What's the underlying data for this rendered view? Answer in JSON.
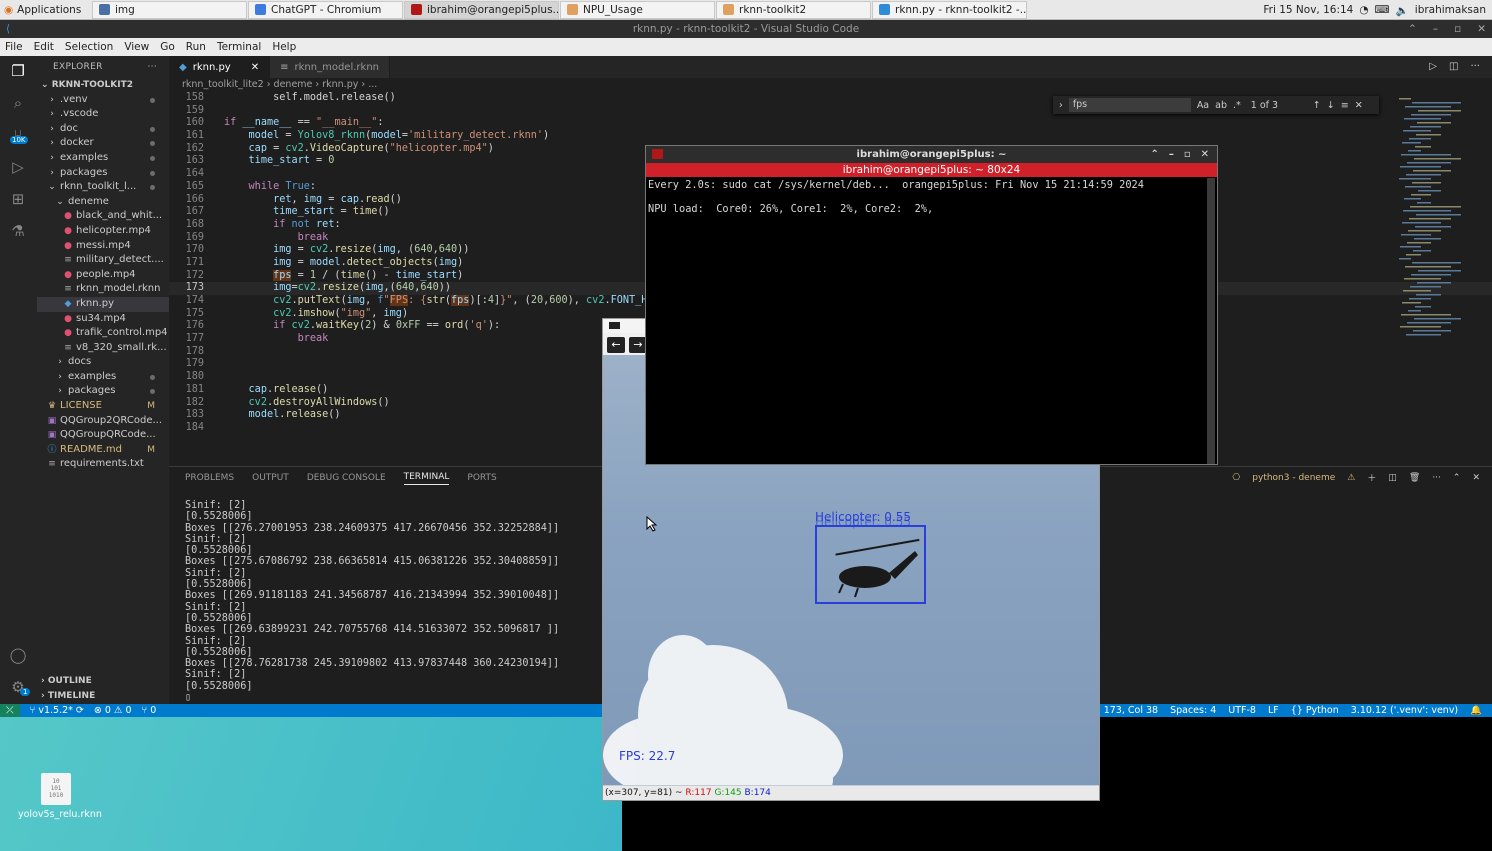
{
  "taskbar": {
    "apps_label": "Applications",
    "tabs": [
      {
        "label": "img",
        "icon": "window-icon",
        "active": false
      },
      {
        "label": "ChatGPT - Chromium",
        "icon": "chromium-icon",
        "active": false
      },
      {
        "label": "ibrahim@orangepi5plus...",
        "icon": "terminal-icon",
        "active": true
      },
      {
        "label": "NPU_Usage",
        "icon": "folder-icon",
        "active": false
      },
      {
        "label": "rknn-toolkit2",
        "icon": "folder-icon",
        "active": false
      },
      {
        "label": "rknn.py - rknn-toolkit2 -...",
        "icon": "vscode-icon",
        "active": false
      }
    ],
    "clock": "Fri 15 Nov, 16:14",
    "user": "ibrahimaksan"
  },
  "window_title": "rknn.py - rknn-toolkit2 - Visual Studio Code",
  "menu": [
    "File",
    "Edit",
    "Selection",
    "View",
    "Go",
    "Run",
    "Terminal",
    "Help"
  ],
  "explorer": {
    "header": "EXPLORER",
    "project": "RKNN-TOOLKIT2",
    "source_control_badge": "10K",
    "settings_badge": "1",
    "items": [
      {
        "label": ".venv",
        "indent": 1,
        "type": "folder",
        "mark": "dot"
      },
      {
        "label": ".vscode",
        "indent": 1,
        "type": "folder",
        "mark": ""
      },
      {
        "label": "doc",
        "indent": 1,
        "type": "folder",
        "mark": "dot"
      },
      {
        "label": "docker",
        "indent": 1,
        "type": "folder",
        "mark": "dot"
      },
      {
        "label": "examples",
        "indent": 1,
        "type": "folder",
        "mark": "dot"
      },
      {
        "label": "packages",
        "indent": 1,
        "type": "folder",
        "mark": "dot"
      },
      {
        "label": "rknn_toolkit_l...",
        "indent": 1,
        "type": "folder-open",
        "mark": "dot"
      },
      {
        "label": "deneme",
        "indent": 2,
        "type": "folder-open",
        "mark": ""
      },
      {
        "label": "black_and_whit...",
        "indent": 3,
        "type": "media",
        "mark": ""
      },
      {
        "label": "helicopter.mp4",
        "indent": 3,
        "type": "media",
        "mark": ""
      },
      {
        "label": "messi.mp4",
        "indent": 3,
        "type": "media",
        "mark": ""
      },
      {
        "label": "military_detect....",
        "indent": 3,
        "type": "file",
        "mark": ""
      },
      {
        "label": "people.mp4",
        "indent": 3,
        "type": "media",
        "mark": ""
      },
      {
        "label": "rknn_model.rknn",
        "indent": 3,
        "type": "file",
        "mark": ""
      },
      {
        "label": "rknn.py",
        "indent": 3,
        "type": "python",
        "mark": "",
        "selected": true
      },
      {
        "label": "su34.mp4",
        "indent": 3,
        "type": "media",
        "mark": ""
      },
      {
        "label": "trafik_control.mp4",
        "indent": 3,
        "type": "media",
        "mark": ""
      },
      {
        "label": "v8_320_small.rk...",
        "indent": 3,
        "type": "file",
        "mark": ""
      },
      {
        "label": "docs",
        "indent": 2,
        "type": "folder",
        "mark": ""
      },
      {
        "label": "examples",
        "indent": 2,
        "type": "folder",
        "mark": "dot"
      },
      {
        "label": "packages",
        "indent": 2,
        "type": "folder",
        "mark": "dot"
      },
      {
        "label": "LICENSE",
        "indent": 1,
        "type": "license",
        "mark": "M"
      },
      {
        "label": "QQGroup2QRCode...",
        "indent": 1,
        "type": "image",
        "mark": ""
      },
      {
        "label": "QQGroupQRCode...",
        "indent": 1,
        "type": "image",
        "mark": ""
      },
      {
        "label": "README.md",
        "indent": 1,
        "type": "info",
        "mark": "M"
      },
      {
        "label": "requirements.txt",
        "indent": 1,
        "type": "file",
        "mark": ""
      }
    ],
    "outline": "OUTLINE",
    "timeline": "TIMELINE"
  },
  "editor": {
    "tabs": [
      {
        "label": "rknn.py",
        "active": true
      },
      {
        "label": "rknn_model.rknn",
        "active": false
      }
    ],
    "breadcrumb": [
      "rknn_toolkit_lite2",
      "deneme",
      "rknn.py",
      "..."
    ],
    "find": {
      "query": "fps",
      "count": "1 of 3"
    },
    "lines": [
      {
        "n": "158",
        "html": "        self.model.release()"
      },
      {
        "n": "159",
        "html": ""
      },
      {
        "n": "160",
        "html": "<span class='kw'>if</span> <span class='var'>__name__</span> == <span class='str'>\"__main__\"</span>:"
      },
      {
        "n": "161",
        "html": "    <span class='var'>model</span> = <span class='cls'>Yolov8_rknn</span>(<span class='var'>model</span>=<span class='str'>'military_detect.rknn'</span>)"
      },
      {
        "n": "162",
        "html": "    <span class='var'>cap</span> = <span class='cls'>cv2</span>.<span class='fn'>VideoCapture</span>(<span class='str'>\"helicopter.mp4\"</span>)"
      },
      {
        "n": "163",
        "html": "    <span class='var'>time_start</span> = <span class='num'>0</span>"
      },
      {
        "n": "164",
        "html": ""
      },
      {
        "n": "165",
        "html": "    <span class='kw'>while</span> <span class='kw2'>True</span>:"
      },
      {
        "n": "166",
        "html": "        <span class='var'>ret</span>, <span class='var'>img</span> = <span class='var'>cap</span>.<span class='fn'>read</span>()"
      },
      {
        "n": "167",
        "html": "        <span class='var'>time_start</span> = <span class='fn'>time</span>()"
      },
      {
        "n": "168",
        "html": "        <span class='kw'>if</span> <span class='kw2'>not</span> <span class='var'>ret</span>:"
      },
      {
        "n": "169",
        "html": "            <span class='kw'>break</span>"
      },
      {
        "n": "170",
        "html": "        <span class='var'>img</span> = <span class='cls'>cv2</span>.<span class='fn'>resize</span>(<span class='var'>img</span>, (<span class='num'>640</span>,<span class='num'>640</span>))"
      },
      {
        "n": "171",
        "html": "        <span class='var'>img</span> = <span class='var'>model</span>.<span class='fn'>detect_objects</span>(<span class='var'>img</span>)"
      },
      {
        "n": "172",
        "html": "        <span class='var hl'>fps</span> = <span class='num'>1</span> / (<span class='fn'>time</span>() - <span class='var'>time_start</span>)"
      },
      {
        "n": "173",
        "html": "        <span class='var'>img</span>=<span class='cls'>cv2</span>.<span class='fn'>resize</span>(<span class='var'>img</span>,(<span class='num'>640</span>,<span class='num'>640</span>))",
        "cur": true
      },
      {
        "n": "174",
        "html": "        <span class='cls'>cv2</span>.<span class='fn'>putText</span>(<span class='var'>img</span>, <span class='kw2'>f</span><span class='str'>\"<span class='hl'>FPS</span>: {</span><span class='fn'>str</span>(<span class='var hl'>fps</span>)[:<span class='num'>4</span>]<span class='str'>}\"</span>, (<span class='num'>20</span>,<span class='num'>600</span>), <span class='cls'>cv2</span>.<span class='var'>FONT_HERSHEY_SIMPLEX</span>"
      },
      {
        "n": "175",
        "html": "        <span class='cls'>cv2</span>.<span class='fn'>imshow</span>(<span class='str'>\"img\"</span>, <span class='var'>img</span>)"
      },
      {
        "n": "176",
        "html": "        <span class='kw'>if</span> <span class='cls'>cv2</span>.<span class='fn'>waitKey</span>(<span class='num'>2</span>) &amp; <span class='num'>0xFF</span> == <span class='fn'>ord</span>(<span class='str'>'q'</span>):"
      },
      {
        "n": "177",
        "html": "            <span class='kw'>break</span>"
      },
      {
        "n": "178",
        "html": ""
      },
      {
        "n": "179",
        "html": ""
      },
      {
        "n": "180",
        "html": ""
      },
      {
        "n": "181",
        "html": "    <span class='var'>cap</span>.<span class='fn'>release</span>()"
      },
      {
        "n": "182",
        "html": "    <span class='cls'>cv2</span>.<span class='fn'>destroyAllWindows</span>()"
      },
      {
        "n": "183",
        "html": "    <span class='var'>model</span>.<span class='fn'>release</span>()"
      },
      {
        "n": "184",
        "html": ""
      }
    ]
  },
  "panel": {
    "tabs": [
      "PROBLEMS",
      "OUTPUT",
      "DEBUG CONSOLE",
      "TERMINAL",
      "PORTS"
    ],
    "active_tab": "TERMINAL",
    "terminal_name": "python3 - deneme",
    "lines": [
      "Sinif: [2]",
      "[0.5528006]",
      "Boxes [[276.27001953 238.24609375 417.26670456 352.32252884]]",
      "Sinif: [2]",
      "[0.5528006]",
      "Boxes [[275.67086792 238.66365814 415.06381226 352.30408859]]",
      "Sinif: [2]",
      "[0.5528006]",
      "Boxes [[269.91181183 241.34568787 416.21343994 352.39010048]]",
      "Sinif: [2]",
      "[0.5528006]",
      "Boxes [[269.63899231 242.70755768 414.51633072 352.5096817 ]]",
      "Sinif: [2]",
      "[0.5528006]",
      "Boxes [[278.76281738 245.39109802 413.97837448 360.24230194]]",
      "Sinif: [2]",
      "[0.5528006]",
      "▯"
    ]
  },
  "status": {
    "branch": "v1.5.2*",
    "errors": "0",
    "warnings": "0",
    "ports": "0",
    "position": "n 173, Col 38",
    "spaces": "Spaces: 4",
    "encoding": "UTF-8",
    "eol": "LF",
    "language": "Python",
    "interpreter": "3.10.12 ('.venv': venv)"
  },
  "npu_terminal": {
    "title": "ibrahim@orangepi5plus: ~",
    "tab": "ibrahim@orangepi5plus: ~ 80x24",
    "lines": [
      "Every 2.0s: sudo cat /sys/kernel/deb...  orangepi5plus: Fri Nov 15 21:14:59 2024",
      "",
      "NPU load:  Core0: 26%, Core1:  2%, Core2:  2%,"
    ]
  },
  "image_window": {
    "detection_label": "Helicopter: 0.55",
    "fps_label": "FPS: 22.7",
    "status_prefix": "(x=307, y=81) ~ ",
    "r": "R:117",
    "g": "G:145",
    "b": "B:174"
  },
  "desktop": {
    "icon_label": "yolov5s_relu.rknn"
  },
  "colors": {
    "vscode_blue": "#007acc",
    "terminal_red": "#d0202a",
    "detection_blue": "#2a3fd9"
  }
}
